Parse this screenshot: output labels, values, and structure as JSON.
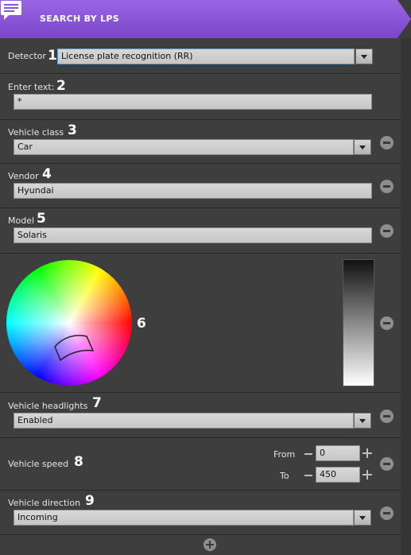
{
  "header": {
    "title": "SEARCH BY LPS",
    "icon": "chat-list-icon",
    "accent": "#8a55d8"
  },
  "detector": {
    "label": "Detector",
    "number": "1",
    "value": "License plate recognition (RR)"
  },
  "enter_text": {
    "label": "Enter text:",
    "number": "2",
    "value": "*"
  },
  "vehicle_class": {
    "label": "Vehicle class",
    "number": "3",
    "value": "Car"
  },
  "vendor": {
    "label": "Vendor",
    "number": "4",
    "value": "Hyundai"
  },
  "model": {
    "label": "Model",
    "number": "5",
    "value": "Solaris"
  },
  "color": {
    "number": "6"
  },
  "headlights": {
    "label": "Vehicle headlights",
    "number": "7",
    "value": "Enabled"
  },
  "speed": {
    "label": "Vehicle speed",
    "number": "8",
    "from_label": "From",
    "from_value": "0",
    "to_label": "To",
    "to_value": "450"
  },
  "direction": {
    "label": "Vehicle direction",
    "number": "9",
    "value": "Incoming"
  }
}
